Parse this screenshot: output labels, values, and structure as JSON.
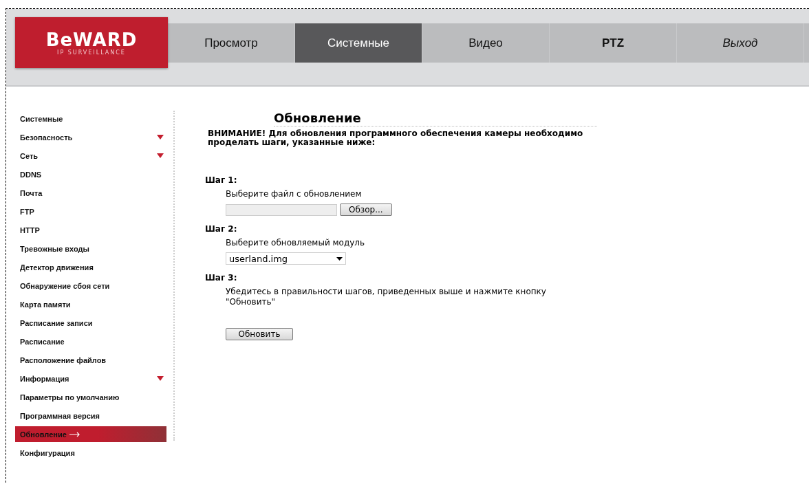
{
  "logo": {
    "brand": "BeWARD",
    "tagline": "IP SURVEILLANCE"
  },
  "tabs": [
    {
      "label": "Просмотр",
      "kind": "plain",
      "selected": false
    },
    {
      "label": "Системные",
      "kind": "plain",
      "selected": true
    },
    {
      "label": "Видео",
      "kind": "plain",
      "selected": false
    },
    {
      "label": "PTZ",
      "kind": "bold",
      "selected": false
    },
    {
      "label": "Выход",
      "kind": "italic",
      "selected": false
    }
  ],
  "sidebar": {
    "items": [
      {
        "label": "Системные",
        "has_submenu": false,
        "selected": false
      },
      {
        "label": "Безопасность",
        "has_submenu": true,
        "selected": false
      },
      {
        "label": "Сеть",
        "has_submenu": true,
        "selected": false
      },
      {
        "label": "DDNS",
        "has_submenu": false,
        "selected": false
      },
      {
        "label": "Почта",
        "has_submenu": false,
        "selected": false
      },
      {
        "label": "FTP",
        "has_submenu": false,
        "selected": false
      },
      {
        "label": "HTTP",
        "has_submenu": false,
        "selected": false
      },
      {
        "label": "Тревожные входы",
        "has_submenu": false,
        "selected": false
      },
      {
        "label": "Детектор движения",
        "has_submenu": false,
        "selected": false
      },
      {
        "label": "Обнаружение сбоя сети",
        "has_submenu": false,
        "selected": false
      },
      {
        "label": "Карта памяти",
        "has_submenu": false,
        "selected": false
      },
      {
        "label": "Расписание записи",
        "has_submenu": false,
        "selected": false
      },
      {
        "label": "Расписание",
        "has_submenu": false,
        "selected": false
      },
      {
        "label": "Расположение файлов",
        "has_submenu": false,
        "selected": false
      },
      {
        "label": "Информация",
        "has_submenu": true,
        "selected": false
      },
      {
        "label": "Параметры по умолчанию",
        "has_submenu": false,
        "selected": false
      },
      {
        "label": "Программная версия",
        "has_submenu": false,
        "selected": false
      },
      {
        "label": "Обновление",
        "has_submenu": false,
        "selected": true
      },
      {
        "label": "Конфигурация",
        "has_submenu": false,
        "selected": false
      }
    ]
  },
  "content": {
    "title": "Обновление",
    "warning": "ВНИМАНИЕ! Для обновления программного обеспечения камеры необходимо проделать шаги, указанные ниже:",
    "steps": [
      {
        "heading": "Шаг 1:",
        "kind": "file",
        "text": "Выберите файл с обновлением",
        "button": "Обзор..."
      },
      {
        "heading": "Шаг 2:",
        "kind": "select",
        "text": "Выберите обновляемый модуль",
        "value": "userland.img"
      },
      {
        "heading": "Шаг 3:",
        "kind": "confirm",
        "text": "Убедитесь в правильности шагов, приведенных выше и нажмите кнопку \"Обновить\"",
        "button": "Обновить"
      }
    ]
  }
}
